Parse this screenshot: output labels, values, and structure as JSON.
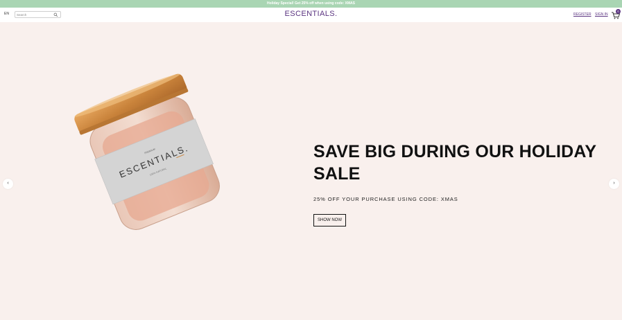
{
  "announcement": "Holiday Special! Get 25% off when using code: XMAS",
  "header": {
    "language": "EN",
    "search_placeholder": "Search",
    "logo": "ESCENTIALS.",
    "register": "REGISTER",
    "sign_in": "SIGN IN",
    "cart_count": "0"
  },
  "hero": {
    "title": "SAVE BIG DURING OUR HOLIDAY SALE",
    "subtitle": "25% OFF YOUR PURCHASE USING CODE: XMAS",
    "cta": "SHOW NOW",
    "product_label_brand": "ESCENTIALS.",
    "product_label_small": "PREMIUM",
    "product_label_detail": "100% NATURAL"
  },
  "colors": {
    "announcement_bg": "#a9d5b3",
    "brand_purple": "#5a3380",
    "hero_bg": "#f9f0ed"
  },
  "icons": [
    "search-icon",
    "cart-icon",
    "chevron-left-icon",
    "chevron-right-icon"
  ]
}
